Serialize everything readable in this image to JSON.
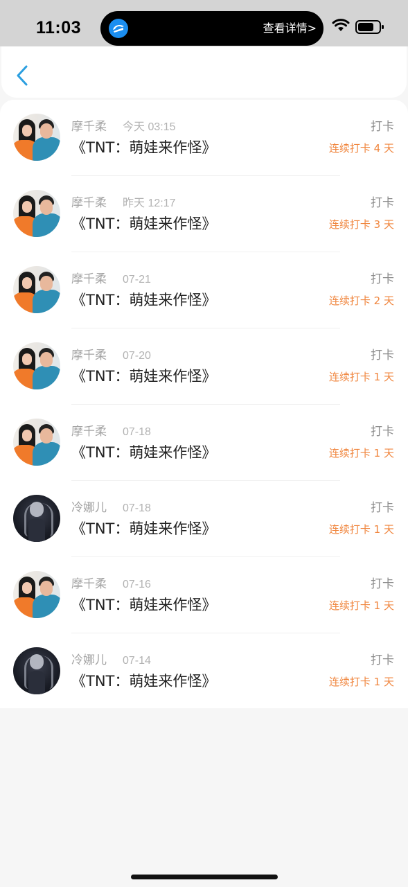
{
  "status_bar": {
    "time": "11:03",
    "island_detail": "查看详情>",
    "icons": [
      "app-icon",
      "wifi-icon",
      "battery-icon"
    ]
  },
  "nav": {
    "back_icon": "chevron-left-icon",
    "accent_color": "#2b9fe0"
  },
  "colors": {
    "streak": "#f0853d",
    "secondary_text": "#a3a3a3"
  },
  "records": [
    {
      "name": "摩千柔",
      "time": "今天 03:15",
      "title": "《TNT：萌娃来作怪》",
      "action": "打卡",
      "streak": "连续打卡 4 天",
      "avatar": "couple"
    },
    {
      "name": "摩千柔",
      "time": "昨天 12:17",
      "title": "《TNT：萌娃来作怪》",
      "action": "打卡",
      "streak": "连续打卡 3 天",
      "avatar": "couple"
    },
    {
      "name": "摩千柔",
      "time": "07-21",
      "title": "《TNT：萌娃来作怪》",
      "action": "打卡",
      "streak": "连续打卡 2 天",
      "avatar": "couple"
    },
    {
      "name": "摩千柔",
      "time": "07-20",
      "title": "《TNT：萌娃来作怪》",
      "action": "打卡",
      "streak": "连续打卡 1 天",
      "avatar": "couple"
    },
    {
      "name": "摩千柔",
      "time": "07-18",
      "title": "《TNT：萌娃来作怪》",
      "action": "打卡",
      "streak": "连续打卡 1 天",
      "avatar": "couple"
    },
    {
      "name": "冷娜儿",
      "time": "07-18",
      "title": "《TNT：萌娃来作怪》",
      "action": "打卡",
      "streak": "连续打卡 1 天",
      "avatar": "dark"
    },
    {
      "name": "摩千柔",
      "time": "07-16",
      "title": "《TNT：萌娃来作怪》",
      "action": "打卡",
      "streak": "连续打卡 1 天",
      "avatar": "couple"
    },
    {
      "name": "冷娜儿",
      "time": "07-14",
      "title": "《TNT：萌娃来作怪》",
      "action": "打卡",
      "streak": "连续打卡 1 天",
      "avatar": "dark"
    }
  ]
}
